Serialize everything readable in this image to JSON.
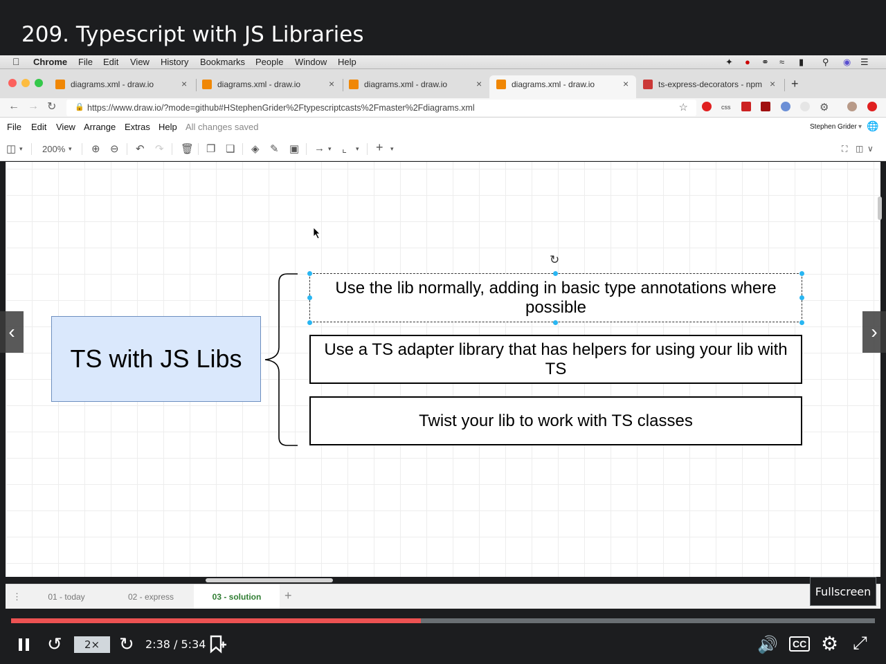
{
  "lecture": {
    "title": "209. Typescript with JS Libraries"
  },
  "mac_menubar": {
    "app": "Chrome",
    "items": [
      "File",
      "Edit",
      "View",
      "History",
      "Bookmarks",
      "People",
      "Window",
      "Help"
    ]
  },
  "browser": {
    "tabs": [
      {
        "title": "diagrams.xml - draw.io",
        "active": false
      },
      {
        "title": "diagrams.xml - draw.io",
        "active": false
      },
      {
        "title": "diagrams.xml - draw.io",
        "active": false
      },
      {
        "title": "diagrams.xml - draw.io",
        "active": true
      },
      {
        "title": "ts-express-decorators - npm",
        "active": false
      }
    ],
    "url": "https://www.draw.io/?mode=github#HStephenGrider%2Ftypescriptcasts%2Fmaster%2Fdiagrams.xml",
    "ext_css": "css"
  },
  "drawio": {
    "menu": [
      "File",
      "Edit",
      "View",
      "Arrange",
      "Extras",
      "Help"
    ],
    "status": "All changes saved",
    "user": "Stephen Grider",
    "zoom": "200%",
    "diagram": {
      "main": "TS with JS Libs",
      "options": [
        "Use the lib normally, adding in basic type annotations where possible",
        "Use a TS adapter library that has helpers for using your lib with TS",
        "Twist your lib to work with TS classes"
      ]
    },
    "pages": [
      {
        "label": "01 - today",
        "active": false
      },
      {
        "label": "02 - express",
        "active": false
      },
      {
        "label": "03 - solution",
        "active": true
      }
    ]
  },
  "player": {
    "progress_fraction": 0.474,
    "speed": "2×",
    "time": "2:38 / 5:34",
    "fullscreen_tooltip": "Fullscreen"
  }
}
